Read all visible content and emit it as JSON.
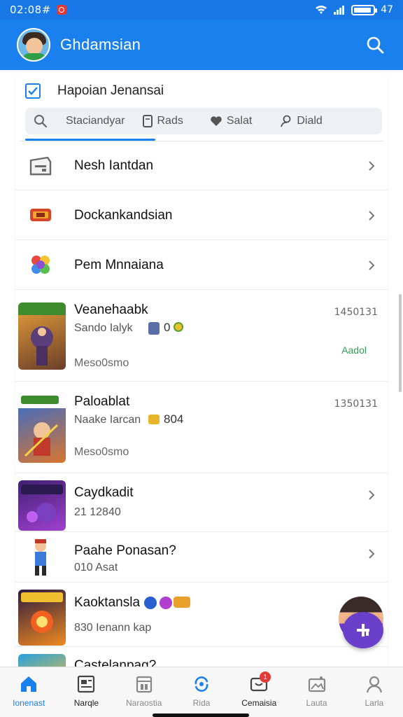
{
  "status_bar": {
    "time": "02:08#",
    "battery": "47"
  },
  "app_bar": {
    "title": "Ghdamsian",
    "search_icon": "search-icon"
  },
  "card": {
    "title": "Hapoian Jenansai",
    "filters": [
      {
        "icon": "bookmark-icon",
        "label": "Staciandyar"
      },
      {
        "icon": "note-icon",
        "label": "Rads"
      },
      {
        "icon": "heart-icon",
        "label": "Salat"
      },
      {
        "icon": "person-icon",
        "label": "Diald"
      }
    ]
  },
  "menu_items": [
    {
      "icon": "card-icon",
      "label": "Nesh Iantdan"
    },
    {
      "icon": "ticket-icon",
      "label": "Dockankandsian"
    },
    {
      "icon": "controller-icon",
      "label": "Pem Mnnaiana"
    }
  ],
  "games": [
    {
      "title": "Veanehaabk",
      "sub": "Sando Ialyk",
      "count": "0",
      "meta": "Meso0smo",
      "date": "1450131",
      "status": "Aadol",
      "colors": [
        "#e8a03a",
        "#6a3f2a"
      ]
    },
    {
      "title": "Paloablat",
      "sub": "Naake Iarcan",
      "count": "804",
      "meta": "Meso0smo",
      "date": "1350131",
      "colors": [
        "#2a6bd6",
        "#d9752f"
      ]
    },
    {
      "title": "Caydkadit",
      "sub": "21 12840",
      "colors": [
        "#402070",
        "#a040d0"
      ]
    },
    {
      "title": "Paahe Ponasan?",
      "sub": "010 Asat",
      "colors": [
        "#ffffff",
        "#3a7ad8"
      ]
    },
    {
      "title": "Kaoktansla",
      "sub": "830 Ienann kap",
      "colors": [
        "#2a1a40",
        "#f08a20"
      ]
    },
    {
      "title": "Castelanpag?"
    }
  ],
  "bottom_nav": [
    {
      "icon": "home-icon",
      "label": "Ionenast",
      "state": "active"
    },
    {
      "icon": "news-icon",
      "label": "Narqle",
      "state": "dark"
    },
    {
      "icon": "calendar-icon",
      "label": "Naraostia",
      "state": ""
    },
    {
      "icon": "refresh-icon",
      "label": "Rida",
      "state": ""
    },
    {
      "icon": "chat-icon",
      "label": "Cemaisia",
      "state": "dark",
      "badge": "1"
    },
    {
      "icon": "image-icon",
      "label": "Lauta",
      "state": ""
    },
    {
      "icon": "profile-icon",
      "label": "Larla",
      "state": ""
    }
  ],
  "accent_color": "#1a80ee",
  "fab_icon": "add-icon"
}
